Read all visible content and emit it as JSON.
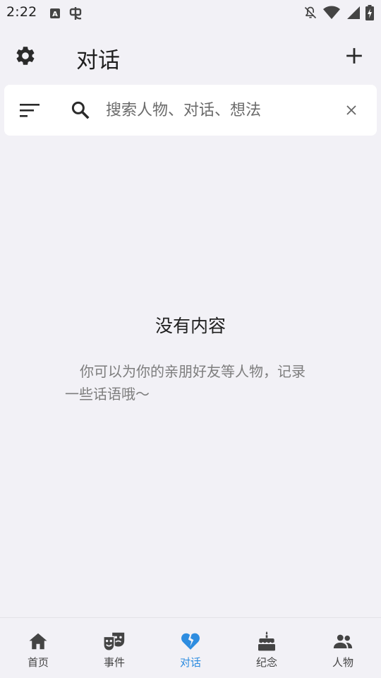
{
  "status_bar": {
    "time": "2:22",
    "left_icons": [
      "a-badge-icon",
      "bug-icon"
    ],
    "right_icons": [
      "notifications-off-icon",
      "wifi-icon",
      "cellular-icon",
      "battery-charging-icon"
    ]
  },
  "app_bar": {
    "title": "对话",
    "settings_icon": "gear-icon",
    "add_icon": "plus-icon"
  },
  "search": {
    "placeholder": "搜索人物、对话、想法",
    "value": "",
    "filter_icon": "filter-list-icon",
    "search_icon": "search-icon",
    "clear_icon": "close-icon"
  },
  "empty_state": {
    "title": "没有内容",
    "description": "你可以为你的亲朋好友等人物，记录一些话语哦～"
  },
  "bottom_nav": {
    "items": [
      {
        "label": "首页",
        "icon": "home-icon",
        "active": false
      },
      {
        "label": "事件",
        "icon": "theater-masks-icon",
        "active": false
      },
      {
        "label": "对话",
        "icon": "broken-heart-icon",
        "active": true
      },
      {
        "label": "纪念",
        "icon": "cake-icon",
        "active": false
      },
      {
        "label": "人物",
        "icon": "people-icon",
        "active": false
      }
    ]
  },
  "colors": {
    "background": "#f2f1f6",
    "surface": "#ffffff",
    "accent": "#2e8de0",
    "icon": "#444444",
    "text_secondary": "#7d7d7d"
  }
}
